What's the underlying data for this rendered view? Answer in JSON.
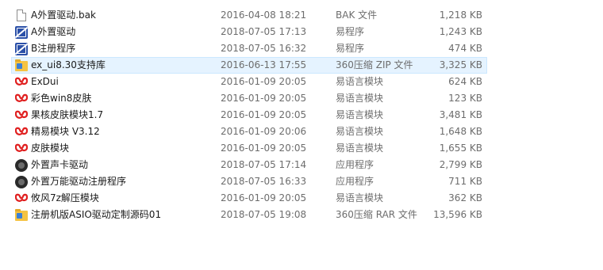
{
  "files": [
    {
      "name": "A外置驱动.bak",
      "date": "2016-04-08 18:21",
      "type": "BAK 文件",
      "size": "1,218 KB",
      "icon": "document-icon",
      "selected": false
    },
    {
      "name": "A外置驱动",
      "date": "2018-07-05 17:13",
      "type": "易程序",
      "size": "1,243 KB",
      "icon": "e-program-icon",
      "selected": false
    },
    {
      "name": "B注册程序",
      "date": "2018-07-05 16:32",
      "type": "易程序",
      "size": "474 KB",
      "icon": "e-program-icon",
      "selected": false
    },
    {
      "name": "ex_ui8.30支持库",
      "date": "2016-06-13 17:55",
      "type": "360压缩 ZIP 文件",
      "size": "3,325 KB",
      "icon": "zip-archive-icon",
      "selected": true
    },
    {
      "name": "ExDui",
      "date": "2016-01-09 20:05",
      "type": "易语言模块",
      "size": "624 KB",
      "icon": "e-module-icon",
      "selected": false
    },
    {
      "name": "彩色win8皮肤",
      "date": "2016-01-09 20:05",
      "type": "易语言模块",
      "size": "123 KB",
      "icon": "e-module-icon",
      "selected": false
    },
    {
      "name": "果核皮肤模块1.7",
      "date": "2016-01-09 20:05",
      "type": "易语言模块",
      "size": "3,481 KB",
      "icon": "e-module-icon",
      "selected": false
    },
    {
      "name": "精易模块 V3.12",
      "date": "2016-01-09 20:06",
      "type": "易语言模块",
      "size": "1,648 KB",
      "icon": "e-module-icon",
      "selected": false
    },
    {
      "name": "皮肤模块",
      "date": "2016-01-09 20:05",
      "type": "易语言模块",
      "size": "1,655 KB",
      "icon": "e-module-icon",
      "selected": false
    },
    {
      "name": "外置声卡驱动",
      "date": "2018-07-05 17:14",
      "type": "应用程序",
      "size": "2,799 KB",
      "icon": "application-icon",
      "selected": false
    },
    {
      "name": "外置万能驱动注册程序",
      "date": "2018-07-05 16:33",
      "type": "应用程序",
      "size": "711 KB",
      "icon": "application-icon",
      "selected": false
    },
    {
      "name": "攸风7z解压模块",
      "date": "2016-01-09 20:05",
      "type": "易语言模块",
      "size": "362 KB",
      "icon": "e-module-icon",
      "selected": false
    },
    {
      "name": "注册机版ASIO驱动定制源码01",
      "date": "2018-07-05 19:08",
      "type": "360压缩 RAR 文件",
      "size": "13,596 KB",
      "icon": "zip-archive-icon",
      "selected": false
    }
  ],
  "colors": {
    "selection_bg": "#e5f3ff",
    "selection_border": "#cce8ff",
    "module_red": "#e02020",
    "program_blue": "#2b50a8"
  }
}
